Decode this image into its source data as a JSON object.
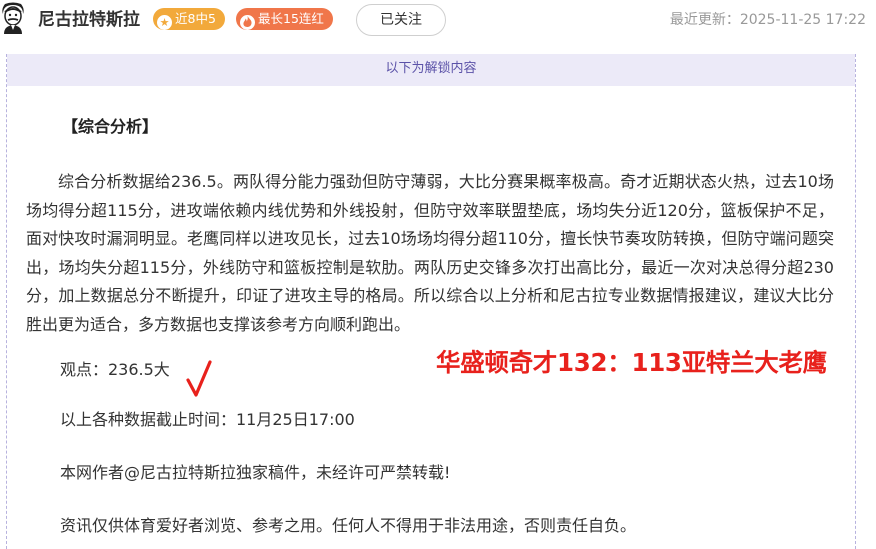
{
  "header": {
    "author": "尼古拉特斯拉",
    "badge_recent": "近8中5",
    "badge_streak": "最长15连红",
    "follow_label": "已关注",
    "last_update": "最近更新：2025-11-25 17:22"
  },
  "content": {
    "unlock_notice": "以下为解锁内容",
    "section_title": "【综合分析】",
    "analysis": "综合分析数据给236.5。两队得分能力强劲但防守薄弱，大比分赛果概率极高。奇才近期状态火热，过去10场场均得分超115分，进攻端依赖内线优势和外线投射，但防守效率联盟垫底，场均失分近120分，篮板保护不足，面对快攻时漏洞明显。老鹰同样以进攻见长，过去10场场均得分超110分，擅长快节奏攻防转换，但防守端问题突出，场均失分超115分，外线防守和篮板控制是软肋。两队历史交锋多次打出高比分，最近一次对决总得分超230分，加上数据总分不断提升，印证了进攻主导的格局。所以综合以上分析和尼古拉专业数据情报建议，建议大比分胜出更为适合，多方数据也支撑该参考方向顺利跑出。",
    "viewpoint": "观点：236.5大",
    "cutoff": "以上各种数据截止时间：11月25日17:00",
    "copyright": "本网作者@尼古拉特斯拉独家稿件，未经许可严禁转载!",
    "disclaimer": "资讯仅供体育爱好者浏览、参考之用。任何人不得用于非法用途，否则责任自负。",
    "result_annotation": "华盛顿奇才132：113亚特兰大老鹰"
  },
  "colors": {
    "accent_purple": "#5b52a8",
    "badge_orange": "#f2a93b",
    "badge_red": "#f0764a",
    "result_red": "#e8211c"
  },
  "icons": {
    "avatar": "tesla-portrait-avatar",
    "recent_badge_icon": "star-icon",
    "streak_badge_icon": "flame-icon",
    "verdict_mark": "check-mark-icon"
  }
}
